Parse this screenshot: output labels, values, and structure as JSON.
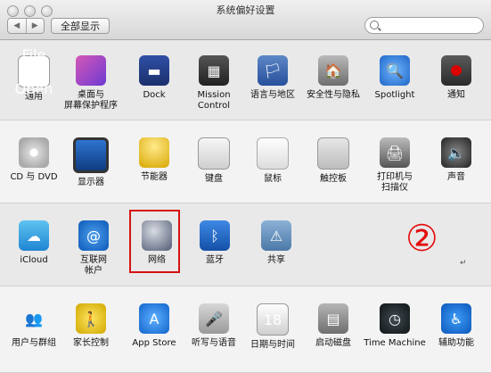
{
  "window": {
    "title": "系统偏好设置",
    "show_all": "全部显示",
    "search_placeholder": "",
    "nav_back": "◀",
    "nav_forward": "▶"
  },
  "rows": [
    [
      {
        "label": "通用",
        "icon": "general-icon",
        "glyph": "File\nNew\nOpen"
      },
      {
        "label": "桌面与\n屏幕保护程序",
        "icon": "desktop-screensaver-icon",
        "glyph": ""
      },
      {
        "label": "Dock",
        "icon": "dock-icon",
        "glyph": "▬"
      },
      {
        "label": "Mission\nControl",
        "icon": "mission-control-icon",
        "glyph": "▦"
      },
      {
        "label": "语言与地区",
        "icon": "language-region-icon",
        "glyph": "🏳"
      },
      {
        "label": "安全性与隐私",
        "icon": "security-privacy-icon",
        "glyph": "🏠"
      },
      {
        "label": "Spotlight",
        "icon": "spotlight-icon",
        "glyph": "🔍"
      },
      {
        "label": "通知",
        "icon": "notifications-icon",
        "glyph": ""
      }
    ],
    [
      {
        "label": "CD 与 DVD",
        "icon": "cd-dvd-icon",
        "glyph": ""
      },
      {
        "label": "显示器",
        "icon": "displays-icon",
        "glyph": ""
      },
      {
        "label": "节能器",
        "icon": "energy-saver-icon",
        "glyph": ""
      },
      {
        "label": "键盘",
        "icon": "keyboard-icon",
        "glyph": ""
      },
      {
        "label": "鼠标",
        "icon": "mouse-icon",
        "glyph": ""
      },
      {
        "label": "触控板",
        "icon": "trackpad-icon",
        "glyph": ""
      },
      {
        "label": "打印机与\n扫描仪",
        "icon": "printers-scanners-icon",
        "glyph": "🖨"
      },
      {
        "label": "声音",
        "icon": "sound-icon",
        "glyph": "🔈"
      }
    ],
    [
      {
        "label": "iCloud",
        "icon": "icloud-icon",
        "glyph": "☁"
      },
      {
        "label": "互联网\n帐户",
        "icon": "internet-accounts-icon",
        "glyph": "@"
      },
      {
        "label": "网络",
        "icon": "network-icon",
        "glyph": ""
      },
      {
        "label": "蓝牙",
        "icon": "bluetooth-icon",
        "glyph": "ᛒ"
      },
      {
        "label": "共享",
        "icon": "sharing-icon",
        "glyph": "⚠"
      }
    ],
    [
      {
        "label": "用户与群组",
        "icon": "users-groups-icon",
        "glyph": "👥"
      },
      {
        "label": "家长控制",
        "icon": "parental-controls-icon",
        "glyph": "🚶"
      },
      {
        "label": "App Store",
        "icon": "app-store-icon",
        "glyph": "A"
      },
      {
        "label": "听写与语音",
        "icon": "dictation-speech-icon",
        "glyph": "🎤"
      },
      {
        "label": "日期与时间",
        "icon": "date-time-icon",
        "glyph": "18"
      },
      {
        "label": "启动磁盘",
        "icon": "startup-disk-icon",
        "glyph": "▤"
      },
      {
        "label": "Time Machine",
        "icon": "time-machine-icon",
        "glyph": "◷"
      },
      {
        "label": "辅助功能",
        "icon": "accessibility-icon",
        "glyph": "♿"
      }
    ]
  ],
  "annotation": {
    "text": "②",
    "color": "#e30d0d",
    "mark": "↵"
  }
}
